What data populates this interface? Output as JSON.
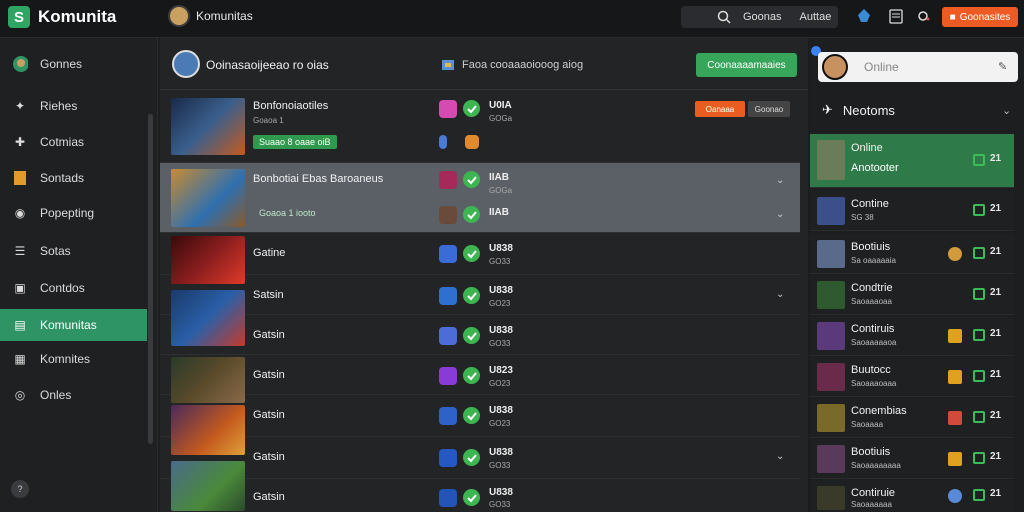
{
  "app": {
    "name": "Komunita",
    "logo_letter": "S"
  },
  "header": {
    "title": "Komunitas",
    "search_placeholder": "Goonas",
    "search_hint": "Auttae",
    "primary_button": "Goonasites"
  },
  "sidebar": {
    "items": [
      {
        "label": "Gonnes",
        "icon": "avatar-icon"
      },
      {
        "label": "Riehes",
        "icon": "star-icon"
      },
      {
        "label": "Cotmias",
        "icon": "puzzle-icon"
      },
      {
        "label": "Sontads",
        "icon": "bookmark-icon"
      },
      {
        "label": "Popepting",
        "icon": "shield-icon"
      },
      {
        "label": "Sotas",
        "icon": "list-icon"
      },
      {
        "label": "Contdos",
        "icon": "folder-icon"
      },
      {
        "label": "Komunitas",
        "icon": "community-icon",
        "active": true
      },
      {
        "label": "Komnites",
        "icon": "cart-icon"
      },
      {
        "label": "Onles",
        "icon": "globe-icon"
      }
    ],
    "bottom": "?"
  },
  "main": {
    "head_title": "Ooinasaoijeeao ro oias",
    "head_sub": "Faoa cooaaaoiooog aiog",
    "head_button": "Coonaaaamaaies",
    "status_a": "Oanaaa",
    "status_b": "Goonao",
    "rows": [
      {
        "title": "Bonfonoiaotiles",
        "sub": "Goaoa 1",
        "tag": "Suaao 8 oaae oiB",
        "version": "U0IA",
        "version_sub": "GOGa",
        "app_color": "#d64bb2",
        "thumb": "#3a5f8c"
      },
      {
        "title": "Bonbotiai Ebas Baroaneus",
        "sub": "Goaoa 1 iooto",
        "version": "IIAB",
        "version_sub": "GOGa",
        "app_color": "#a52a5a",
        "thumb": "#c78b32",
        "chevron": true
      },
      {
        "title": "Gatine",
        "version": "U838",
        "version_sub": "GO33",
        "app_color": "#3b6bd6",
        "thumb": "#8a1e1e"
      },
      {
        "title": "Satsin",
        "version": "U838",
        "version_sub": "GO23",
        "app_color": "#2f6fd0",
        "thumb": "#2a5fa8",
        "chevron": true
      },
      {
        "title": "Gatsin",
        "version": "U838",
        "version_sub": "GO33",
        "app_color": "#4e6cd8",
        "thumb": "#3e5a3a"
      },
      {
        "title": "Gatsin",
        "version": "U823",
        "version_sub": "GO23",
        "app_color": "#8a3ad6",
        "thumb": "#5a4a2a"
      },
      {
        "title": "Gatsin",
        "version": "U838",
        "version_sub": "GO23",
        "app_color": "#2e62c9",
        "thumb": "#c45a1e"
      },
      {
        "title": "Gatsin",
        "version": "U838",
        "version_sub": "GO33",
        "app_color": "#2558c2",
        "thumb": "#4a6a8a",
        "chevron": true
      },
      {
        "title": "Gatsin",
        "version": "U838",
        "version_sub": "GO33",
        "app_color": "#2454b8",
        "thumb": "#4a8a3a"
      }
    ]
  },
  "right": {
    "search_text": "Online",
    "section_title": "Neotoms",
    "rows": [
      {
        "name": "Online",
        "sub": "Anotooter",
        "count": "21",
        "thumb": "#6b7c5a",
        "active": true
      },
      {
        "name": "Contine",
        "sub": "SG 38",
        "count": "21",
        "thumb": "#3b4f8a"
      },
      {
        "name": "Bootiuis",
        "sub": "Sa oaaaaaia",
        "count": "21",
        "thumb": "#5a6a8a",
        "accent": "#d19a3a"
      },
      {
        "name": "Condtrie",
        "sub": "Saoaaaoaa",
        "count": "21",
        "thumb": "#2f5a2f"
      },
      {
        "name": "Contiruis",
        "sub": "Saoaaaaaoa",
        "count": "21",
        "thumb": "#5a3a7a",
        "accent": "#e0a020"
      },
      {
        "name": "Buutocc",
        "sub": "Saoaaaoaaa",
        "count": "21",
        "thumb": "#6a2a4a",
        "accent": "#e0a020"
      },
      {
        "name": "Conembias",
        "sub": "Saoaaaa",
        "count": "21",
        "thumb": "#7a6a2a",
        "accent": "#d14a3a"
      },
      {
        "name": "Bootiuis",
        "sub": "Saoaaaaaaaa",
        "count": "21",
        "thumb": "#5a3a5a",
        "accent": "#e0a020"
      },
      {
        "name": "Contiruie",
        "sub": "Saoaaaaaa",
        "count": "21",
        "thumb": "#3a3a2a",
        "accent": "#5a8ad6"
      }
    ]
  }
}
